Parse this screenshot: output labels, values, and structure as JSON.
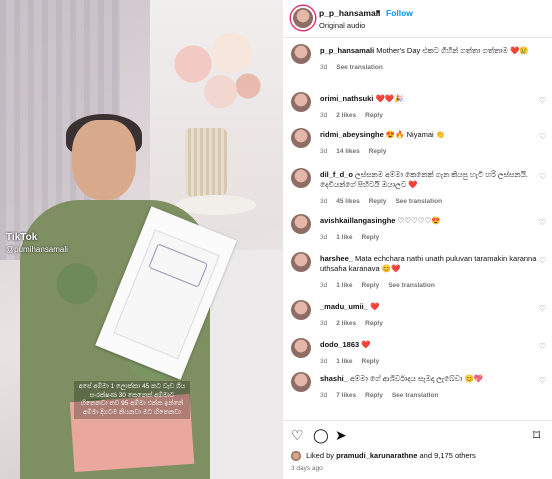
{
  "post": {
    "username": "p_p_hansamali",
    "follow_label": "Follow",
    "dot": "•",
    "audio": "Original audio",
    "media": {
      "watermark": "TikTok",
      "watermark_user": "@pumihansamali",
      "overlay_text": "අපේ අම්මා 1 ලොක්කා 45 කට වැඩ ගිය සංරක්ෂණ 30 කෙනෙක් අම්මාට හිතෙනවා තව 95 අම්මා එක්ක ඉන්නේ අම්මා දිගටම කියනවා මට හිතෙනවා"
    }
  },
  "comments": [
    {
      "user": "p_p_hansamali",
      "text": "Mother's Day එකට ගිහින් ගත්තා ගත්තාම ❤️😢",
      "time": "3d",
      "likes": "",
      "reply": "",
      "translation": "See translation"
    },
    {
      "user": "orimi_nathsuki",
      "text": "❤️❤️🎉",
      "time": "3d",
      "likes": "2 likes",
      "reply": "Reply",
      "translation": ""
    },
    {
      "user": "ridmi_abeysinghe",
      "text": "😍🔥 Niyamai 👏",
      "time": "3d",
      "likes": "14 likes",
      "reply": "Reply",
      "translation": ""
    },
    {
      "user": "dil_f_d_o",
      "text": "ලස්සනම අම්මා කෙනෙක් ගැන කියපු හැටි හරි ලස්සනයි. දෙවියන්ගේ පිහිටයි ඔයාලට ❤️",
      "time": "3d",
      "likes": "45 likes",
      "reply": "Reply",
      "translation": "See translation"
    },
    {
      "user": "avishkaillangasinghe",
      "text": "♡♡♡♡♡😍",
      "time": "3d",
      "likes": "1 like",
      "reply": "Reply",
      "translation": ""
    },
    {
      "user": "harshee_",
      "text": "Mata echchara nathi unath puluvan taramakin karanna uthsaha karanava 😊❤️",
      "time": "3d",
      "likes": "1 like",
      "reply": "Reply",
      "translation": "See translation"
    },
    {
      "user": "_madu_umii_",
      "text": "❤️",
      "time": "3d",
      "likes": "2 likes",
      "reply": "Reply",
      "translation": ""
    },
    {
      "user": "dodo_1863",
      "text": "❤️",
      "time": "3d",
      "likes": "1 like",
      "reply": "Reply",
      "translation": ""
    },
    {
      "user": "shashi_",
      "text": "අම්මා ගේ ආශිර්වාදය සැමදා ලැබේවා 😊💖",
      "time": "3d",
      "likes": "7 likes",
      "reply": "Reply",
      "translation": "See translation"
    }
  ],
  "actions": {
    "like_icon": "heart-outline-icon",
    "comment_icon": "comment-icon",
    "share_icon": "share-icon",
    "save_icon": "bookmark-icon"
  },
  "liked_by": {
    "prefix": "Liked by",
    "user": "pramudi_karunarathne",
    "suffix": "and 9,175 others"
  },
  "time_ago": "3 days ago",
  "colors": {
    "follow": "#0095f6",
    "muted": "#737373"
  }
}
